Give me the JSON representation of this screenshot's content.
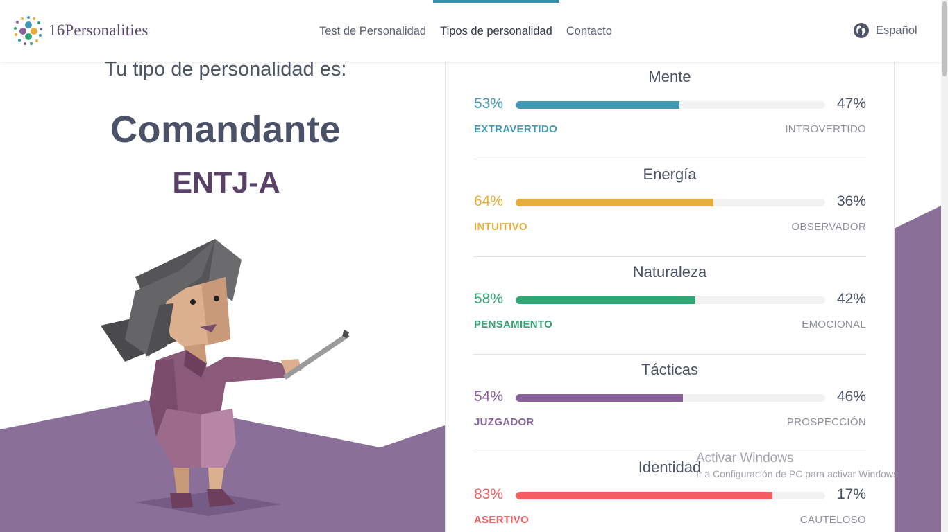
{
  "header": {
    "logo_text": "16Personalities",
    "nav": [
      {
        "label": "Test de Personalidad",
        "active": false
      },
      {
        "label": "Tipos de personalidad",
        "active": true
      },
      {
        "label": "Contacto",
        "active": false
      }
    ],
    "language": "Español",
    "accent_color": "#3a8eaa"
  },
  "result": {
    "subtitle": "Tu tipo de personalidad es:",
    "type_name": "Comandante",
    "type_code": "ENTJ-A",
    "theme_color": "#8a7099"
  },
  "traits": [
    {
      "title": "Mente",
      "left_pct": "53%",
      "right_pct": "47%",
      "value": 53,
      "left_label": "EXTRAVERTIDO",
      "right_label": "INTROVERTIDO",
      "color": "#4298b4"
    },
    {
      "title": "Energía",
      "left_pct": "64%",
      "right_pct": "36%",
      "value": 64,
      "left_label": "INTUITIVO",
      "right_label": "OBSERVADOR",
      "color": "#e4ae3a"
    },
    {
      "title": "Naturaleza",
      "left_pct": "58%",
      "right_pct": "42%",
      "value": 58,
      "left_label": "PENSAMIENTO",
      "right_label": "EMOCIONAL",
      "color": "#33a474"
    },
    {
      "title": "Tácticas",
      "left_pct": "54%",
      "right_pct": "46%",
      "value": 54,
      "left_label": "JUZGADOR",
      "right_label": "PROSPECCIÓN",
      "color": "#88619a"
    },
    {
      "title": "Identidad",
      "left_pct": "83%",
      "right_pct": "17%",
      "value": 83,
      "left_label": "ASERTIVO",
      "right_label": "CAUTELOSO",
      "color": "#f25e62"
    }
  ],
  "watermark": {
    "title": "Activar Windows",
    "subtitle": "Ir a Configuración de PC para activar Windows."
  }
}
